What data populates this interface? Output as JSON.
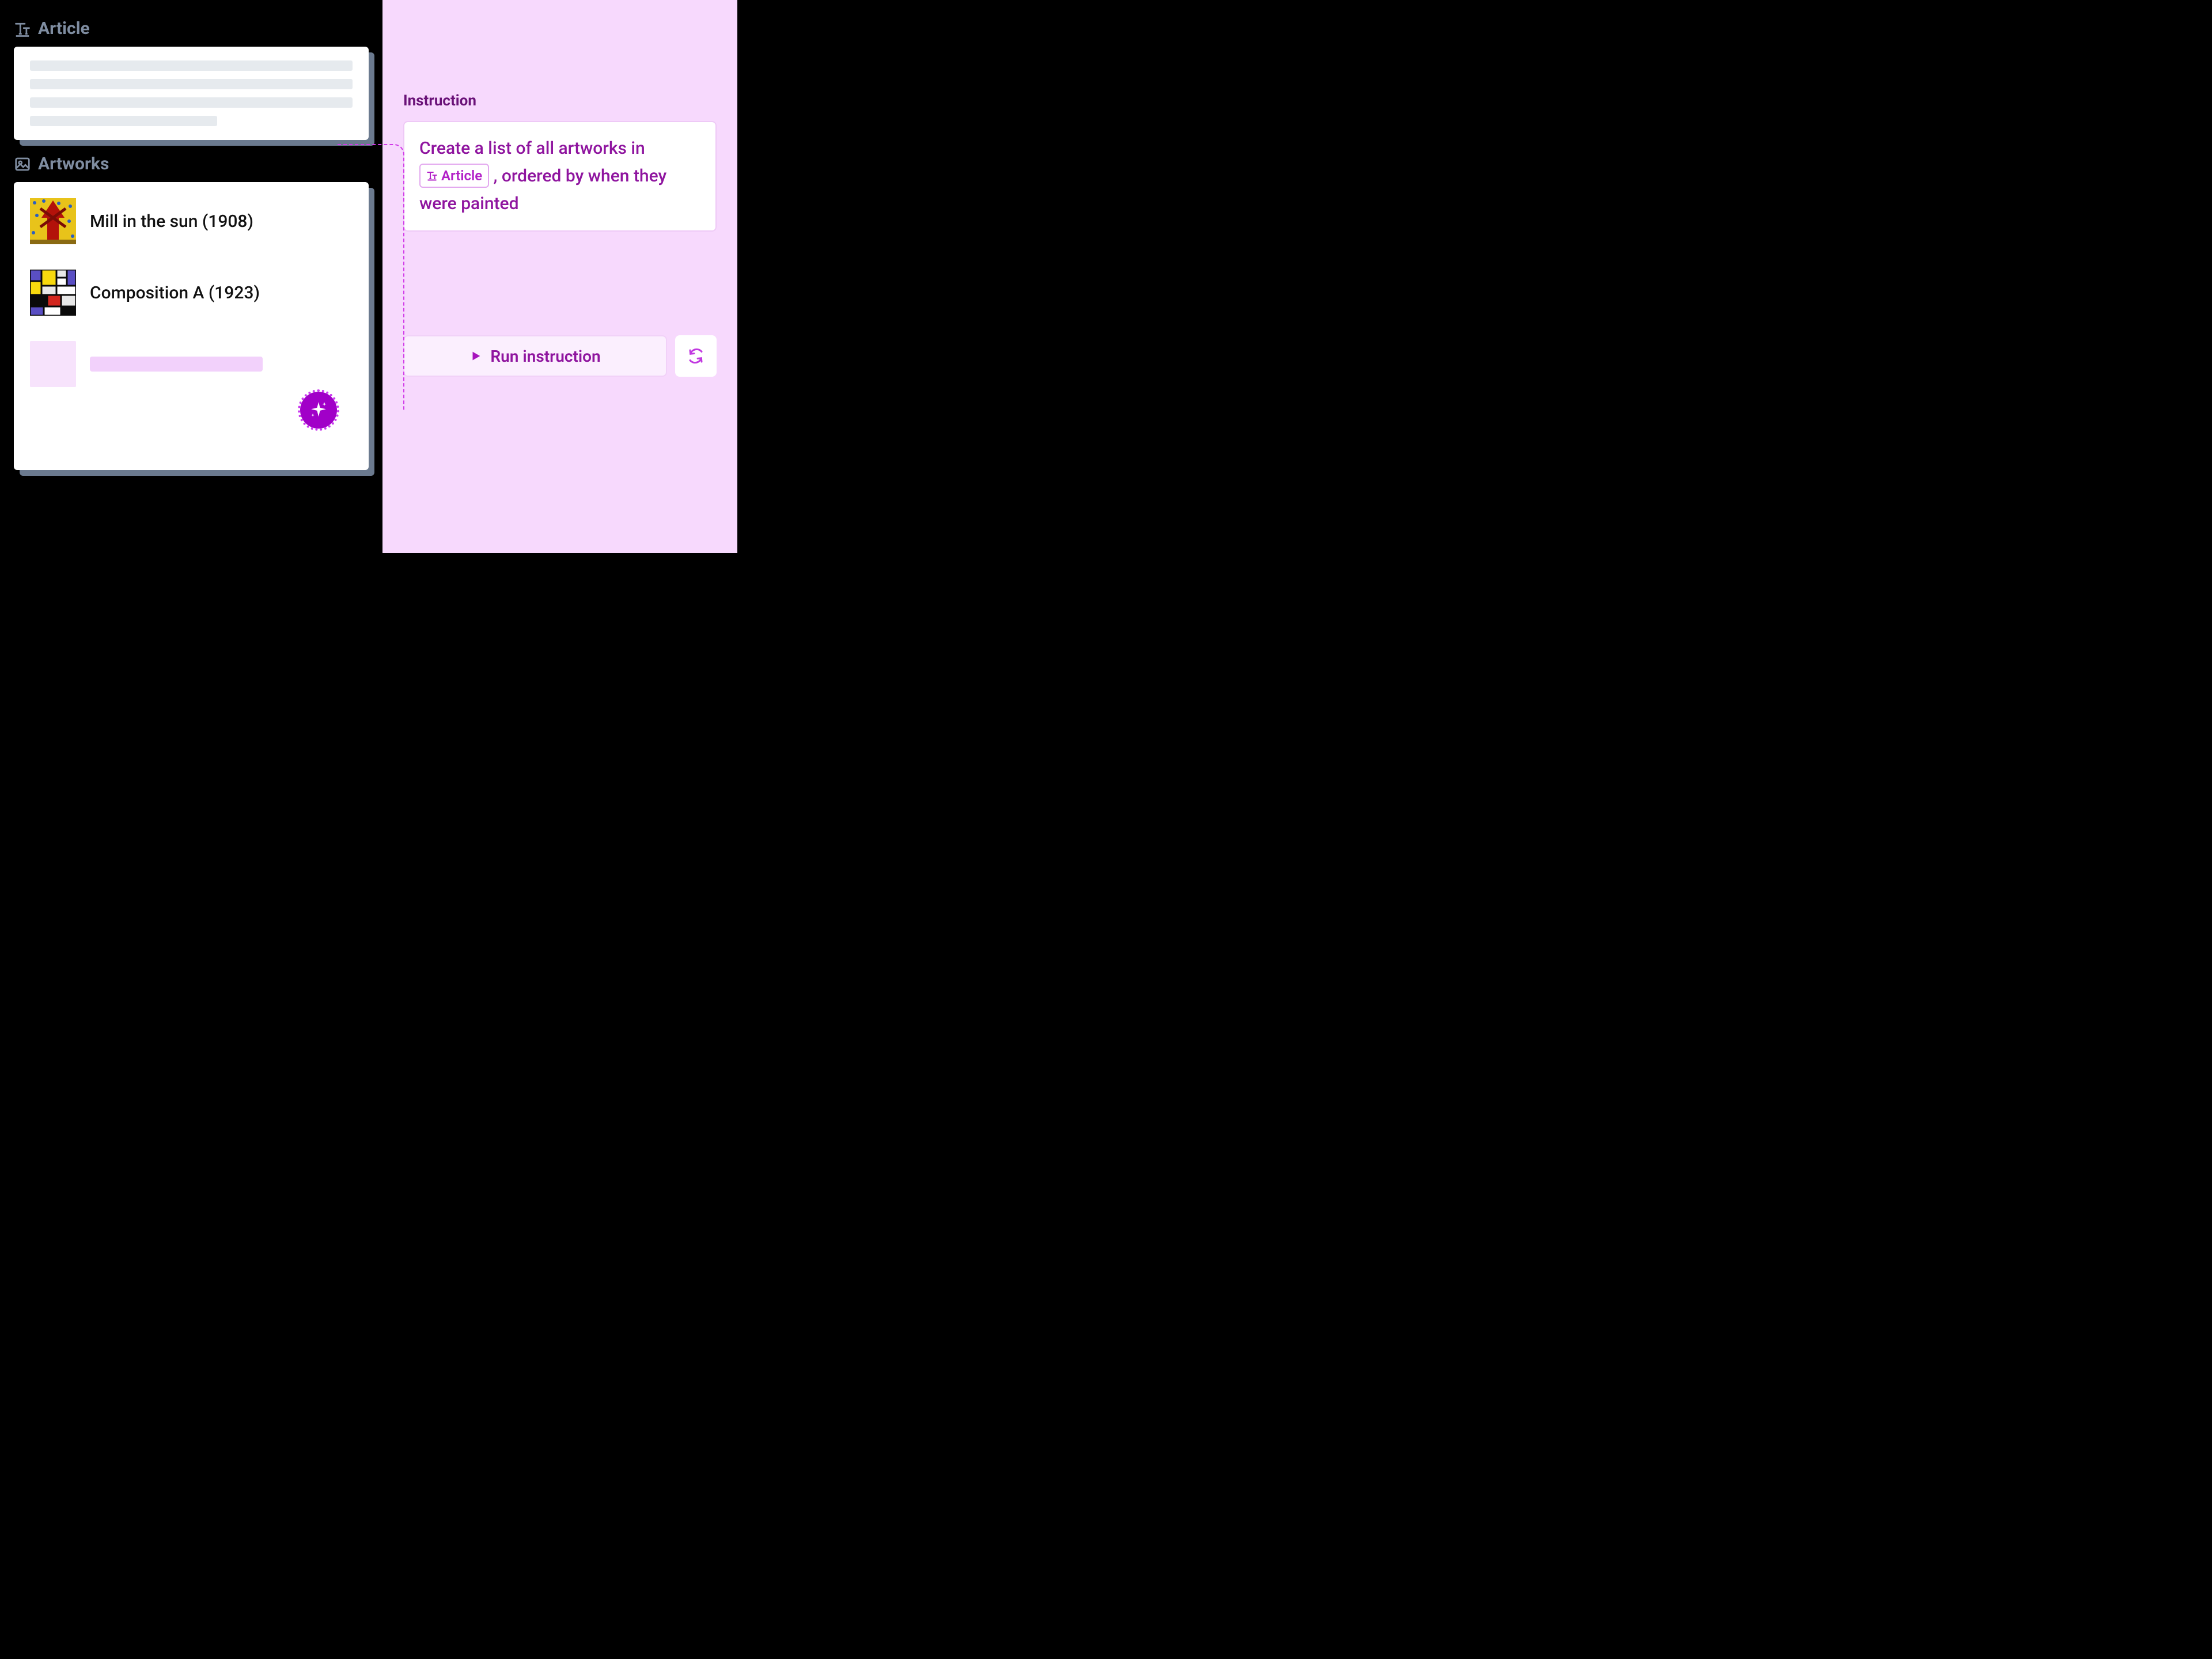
{
  "left": {
    "article": {
      "heading": "Article"
    },
    "artworks": {
      "heading": "Artworks",
      "items": [
        {
          "title": "Mill in the sun (1908)"
        },
        {
          "title": "Composition A (1923)"
        }
      ]
    }
  },
  "right": {
    "instruction_label": "Instruction",
    "instruction": {
      "prefix": "Create a list of all artworks in ",
      "chip_label": "Article",
      "suffix": " , ordered by when they were painted"
    },
    "run_button": "Run instruction"
  }
}
